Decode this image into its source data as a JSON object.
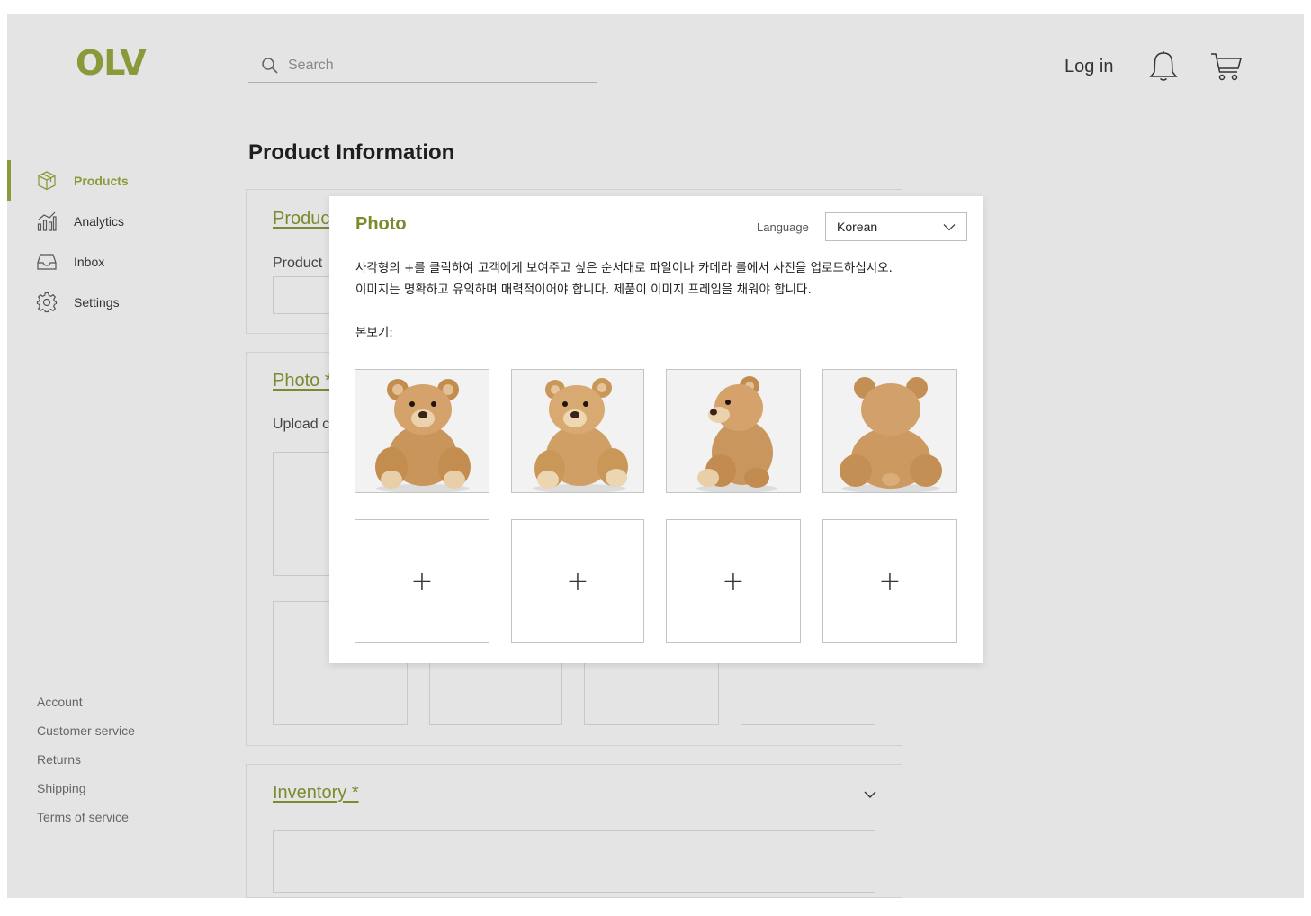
{
  "brand": {
    "logo": "OLV",
    "accent": "#8a9a3a"
  },
  "sidebar": {
    "items": [
      {
        "label": "Products",
        "icon": "box-icon",
        "active": true
      },
      {
        "label": "Analytics",
        "icon": "analytics-icon",
        "active": false
      },
      {
        "label": "Inbox",
        "icon": "inbox-icon",
        "active": false
      },
      {
        "label": "Settings",
        "icon": "gear-icon",
        "active": false
      }
    ],
    "footer_links": [
      "Account",
      "Customer service",
      "Returns",
      "Shipping",
      "Terms of service"
    ]
  },
  "header": {
    "search_placeholder": "Search",
    "login_label": "Log in",
    "icons": [
      "search-icon",
      "bell-icon",
      "cart-icon"
    ]
  },
  "page": {
    "title": "Product Information",
    "cards": {
      "product": {
        "title": "Produc",
        "label": "Product"
      },
      "photo": {
        "title": "Photo *",
        "label": "Upload c"
      },
      "inventory": {
        "title": "Inventory *"
      }
    }
  },
  "photo_modal": {
    "title": "Photo",
    "language_label": "Language",
    "language_value": "Korean",
    "description_line1": "사각형의 +를 클릭하여 고객에게 보여주고 싶은 순서대로 파일이나 카메라 롤에서 사진을 업로드하십시오.",
    "description_line2": "이미지는 명확하고 유익하며 매력적이어야 합니다. 제품이 이미지 프레임을 채워야 합니다.",
    "sample_label": "본보기:",
    "sample_photos": [
      "teddy-bear-front",
      "teddy-bear-three-quarter",
      "teddy-bear-side",
      "teddy-bear-back"
    ],
    "upload_slot_symbol": "+"
  }
}
